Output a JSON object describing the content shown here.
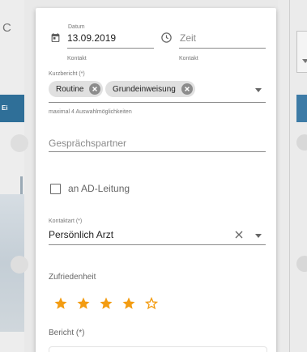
{
  "background": {
    "left_fragment": "C",
    "left_blue_bar_text": "Ei"
  },
  "dialog": {
    "datum": {
      "label": "Datum",
      "value": "13.09.2019",
      "helper": "Kontakt",
      "icon": "calendar-icon"
    },
    "zeit": {
      "placeholder": "Zeit",
      "helper": "Kontakt",
      "icon": "clock-icon"
    },
    "kurzbericht": {
      "label": "Kurzbericht (*)",
      "chips": [
        "Routine",
        "Grundeinweisung"
      ],
      "hint": "maximal 4 Auswahlmöglichkeiten"
    },
    "gespraechspartner": {
      "placeholder": "Gesprächspartner"
    },
    "ad_leitung": {
      "label": "an AD-Leitung",
      "checked": false
    },
    "kontaktart": {
      "label": "Kontaktart (*)",
      "value": "Persönlich Arzt"
    },
    "zufriedenheit": {
      "label": "Zufriedenheit",
      "rating": 4,
      "max": 5,
      "star_color": "#f39c12"
    },
    "bericht": {
      "label": "Bericht (*)"
    }
  }
}
